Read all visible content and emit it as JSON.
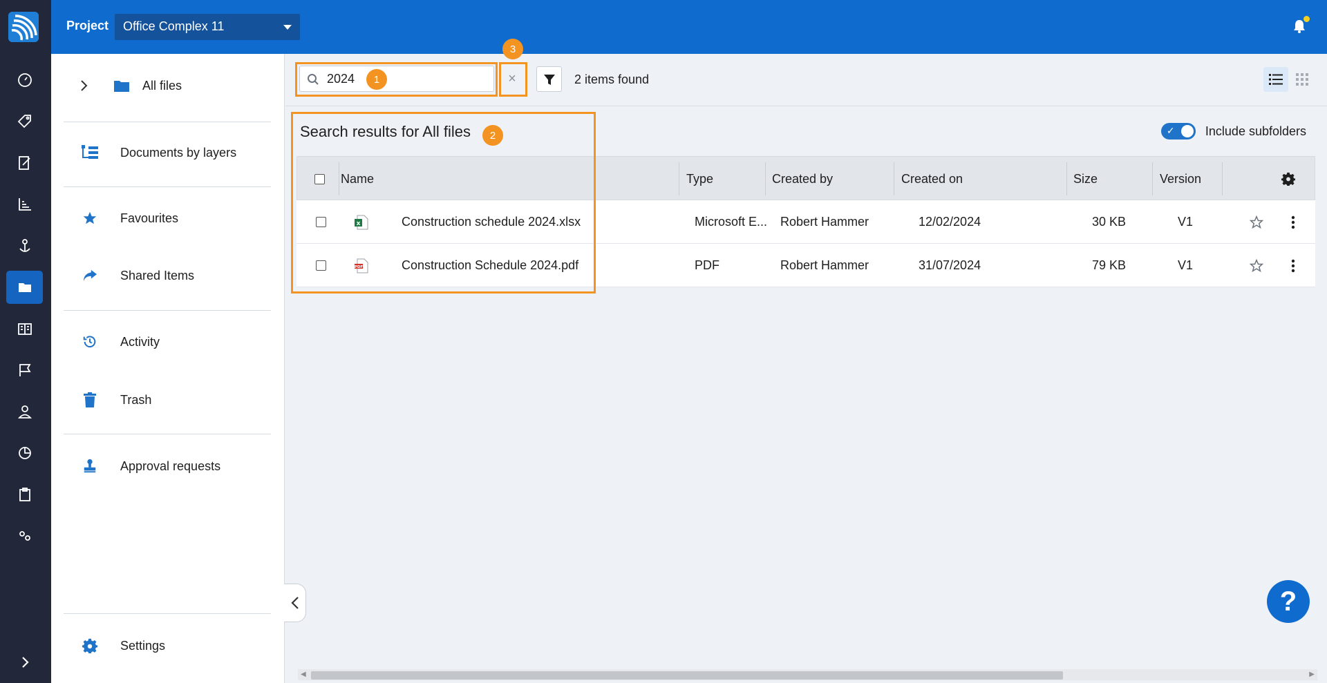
{
  "header": {
    "project_label": "Project",
    "project_name": "Office Complex 11"
  },
  "sidebar": {
    "items": [
      {
        "label": "All files",
        "icon": "folder-icon"
      },
      {
        "label": "Documents by layers",
        "icon": "layers-icon"
      },
      {
        "label": "Favourites",
        "icon": "star-icon"
      },
      {
        "label": "Shared Items",
        "icon": "share-icon"
      },
      {
        "label": "Activity",
        "icon": "history-icon"
      },
      {
        "label": "Trash",
        "icon": "trash-icon"
      },
      {
        "label": "Approval requests",
        "icon": "stamp-icon"
      },
      {
        "label": "Settings",
        "icon": "gear-icon"
      }
    ]
  },
  "toolbar": {
    "search_value": "2024",
    "clear_label": "×",
    "items_found": "2 items found"
  },
  "callouts": {
    "one": "1",
    "two": "2",
    "three": "3"
  },
  "results": {
    "title": "Search results for All files",
    "include_subfolders": "Include subfolders",
    "columns": [
      "Name",
      "Type",
      "Created by",
      "Created on",
      "Size",
      "Version"
    ],
    "rows": [
      {
        "name": "Construction schedule 2024.xlsx",
        "type": "Microsoft E...",
        "created_by": "Robert Hammer",
        "created_on": "12/02/2024",
        "size": "30 KB",
        "version": "V1",
        "file_icon": "excel-file-icon"
      },
      {
        "name": "Construction Schedule 2024.pdf",
        "type": "PDF",
        "created_by": "Robert Hammer",
        "created_on": "31/07/2024",
        "size": "79 KB",
        "version": "V1",
        "file_icon": "pdf-file-icon"
      }
    ]
  },
  "help_label": "?",
  "colors": {
    "brand": "#0f6cce",
    "rail": "#22283a",
    "callout": "#f39322"
  }
}
